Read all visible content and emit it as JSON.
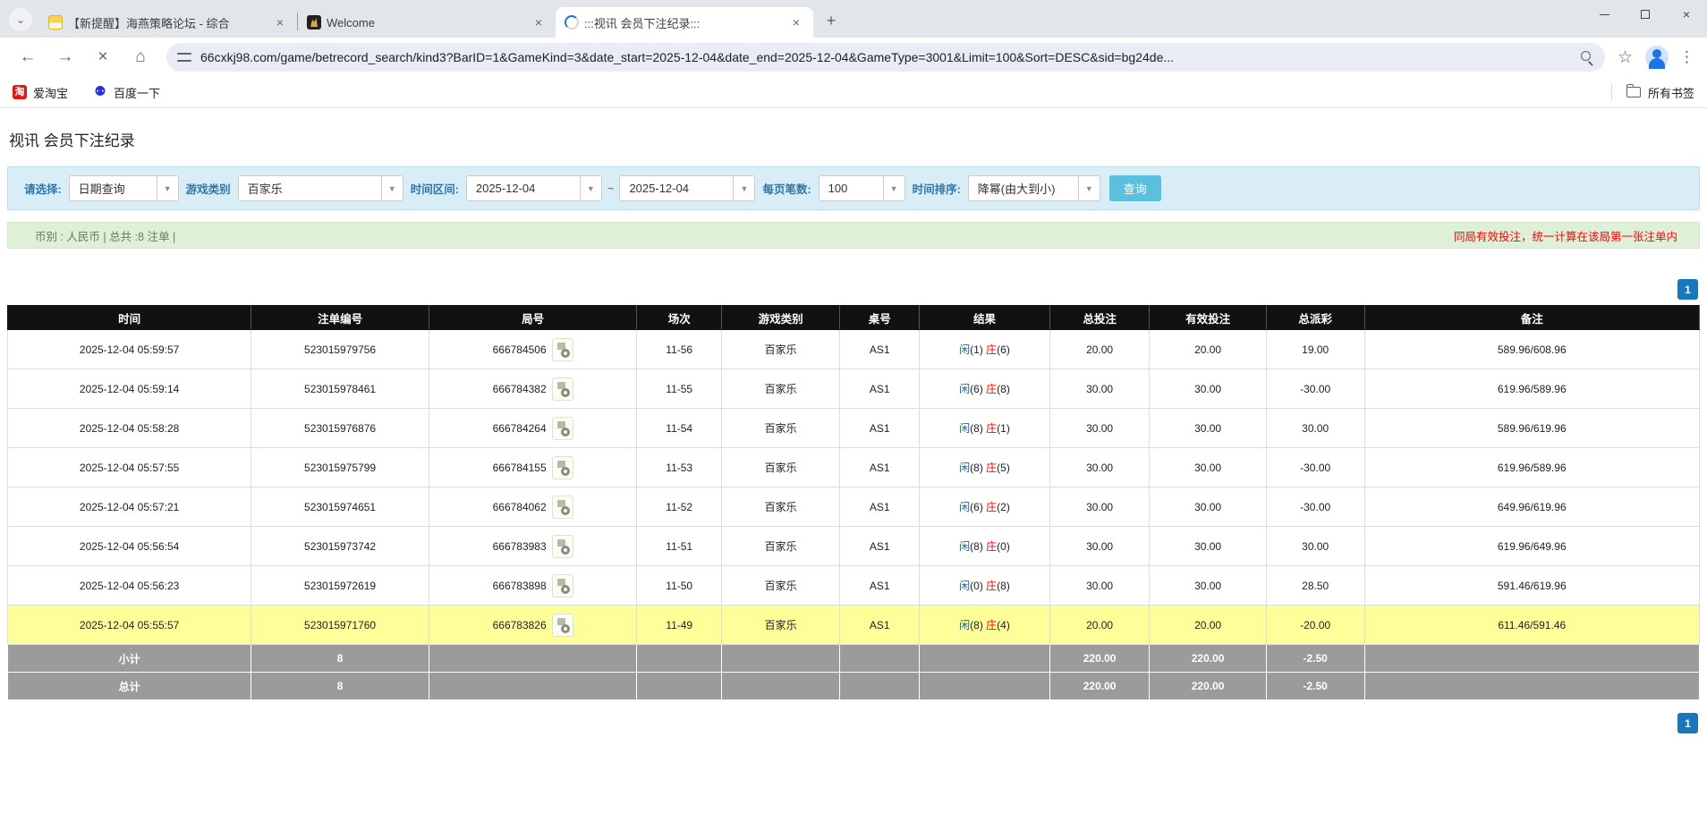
{
  "colors": {
    "accent_blue": "#0066cc",
    "negative_red": "#ff0000",
    "highlight_yellow": "#ffff99",
    "header_black": "#111111",
    "summary_gray": "#9b9b9b",
    "filter_bg": "#d9edf7",
    "info_bg": "#dff0d8",
    "search_button_cyan": "#5bc0de",
    "pagination_blue": "#1778be"
  },
  "browser": {
    "tabs": [
      {
        "title": "【新提醒】海燕策略论坛 - 综合",
        "active": false,
        "favicon": "mail-icon"
      },
      {
        "title": "Welcome",
        "active": false,
        "favicon": "dark-gold-icon"
      },
      {
        "title": ":::视讯 会员下注纪录:::",
        "active": true,
        "favicon": "loading-spinner-icon"
      }
    ],
    "newtab_label": "+",
    "url": "66cxkj98.com/game/betrecord_search/kind3?BarID=1&GameKind=3&date_start=2025-12-04&date_end=2025-12-04&GameType=3001&Limit=100&Sort=DESC&sid=bg24de...",
    "bookmarks": [
      {
        "label": "爱淘宝",
        "icon": "taobao-icon",
        "icon_glyph": "淘"
      },
      {
        "label": "百度一下",
        "icon": "baidu-icon",
        "icon_glyph": "⚉"
      }
    ],
    "all_bookmarks_label": "所有书签"
  },
  "page": {
    "title": "视讯 会员下注纪录",
    "filters": {
      "select_label": "请选择:",
      "select_value": "日期查询",
      "game_label": "游戏类别",
      "game_value": "百家乐",
      "range_label": "时间区间:",
      "date_start": "2025-12-04",
      "tilde": "~",
      "date_end": "2025-12-04",
      "per_page_label": "每页笔数:",
      "per_page_value": "100",
      "sort_label": "时间排序:",
      "sort_value": "降幂(由大到小)",
      "search_button": "查询",
      "dropdown_arrow": "▼"
    },
    "info_bar": {
      "left": "币别 : 人民币 | 总共 :8 注单 |",
      "right": "同局有效投注，统一计算在该局第一张注单内"
    },
    "pagination_page": "1",
    "table": {
      "headers": [
        "时间",
        "注单编号",
        "局号",
        "场次",
        "游戏类别",
        "桌号",
        "结果",
        "总投注",
        "有效投注",
        "总派彩",
        "备注"
      ],
      "rows": [
        {
          "time": "2025-12-04 05:59:57",
          "bet_id": "523015979756",
          "round": "666784506",
          "session": "11-56",
          "game": "百家乐",
          "table_no": "AS1",
          "result": {
            "xian": "闲",
            "xian_n": "(1)",
            "zhuang": "庄",
            "zhuang_n": "(6)"
          },
          "total_bet": "20.00",
          "valid_bet": "20.00",
          "payout": "19.00",
          "remark": "589.96/608.96",
          "highlight": false
        },
        {
          "time": "2025-12-04 05:59:14",
          "bet_id": "523015978461",
          "round": "666784382",
          "session": "11-55",
          "game": "百家乐",
          "table_no": "AS1",
          "result": {
            "xian": "闲",
            "xian_n": "(6)",
            "zhuang": "庄",
            "zhuang_n": "(8)"
          },
          "total_bet": "30.00",
          "valid_bet": "30.00",
          "payout": "-30.00",
          "remark": "619.96/589.96",
          "highlight": false
        },
        {
          "time": "2025-12-04 05:58:28",
          "bet_id": "523015976876",
          "round": "666784264",
          "session": "11-54",
          "game": "百家乐",
          "table_no": "AS1",
          "result": {
            "xian": "闲",
            "xian_n": "(8)",
            "zhuang": "庄",
            "zhuang_n": "(1)"
          },
          "total_bet": "30.00",
          "valid_bet": "30.00",
          "payout": "30.00",
          "remark": "589.96/619.96",
          "highlight": false
        },
        {
          "time": "2025-12-04 05:57:55",
          "bet_id": "523015975799",
          "round": "666784155",
          "session": "11-53",
          "game": "百家乐",
          "table_no": "AS1",
          "result": {
            "xian": "闲",
            "xian_n": "(8)",
            "zhuang": "庄",
            "zhuang_n": "(5)"
          },
          "total_bet": "30.00",
          "valid_bet": "30.00",
          "payout": "-30.00",
          "remark": "619.96/589.96",
          "highlight": false
        },
        {
          "time": "2025-12-04 05:57:21",
          "bet_id": "523015974651",
          "round": "666784062",
          "session": "11-52",
          "game": "百家乐",
          "table_no": "AS1",
          "result": {
            "xian": "闲",
            "xian_n": "(6)",
            "zhuang": "庄",
            "zhuang_n": "(2)"
          },
          "total_bet": "30.00",
          "valid_bet": "30.00",
          "payout": "-30.00",
          "remark": "649.96/619.96",
          "highlight": false
        },
        {
          "time": "2025-12-04 05:56:54",
          "bet_id": "523015973742",
          "round": "666783983",
          "session": "11-51",
          "game": "百家乐",
          "table_no": "AS1",
          "result": {
            "xian": "闲",
            "xian_n": "(8)",
            "zhuang": "庄",
            "zhuang_n": "(0)"
          },
          "total_bet": "30.00",
          "valid_bet": "30.00",
          "payout": "30.00",
          "remark": "619.96/649.96",
          "highlight": false
        },
        {
          "time": "2025-12-04 05:56:23",
          "bet_id": "523015972619",
          "round": "666783898",
          "session": "11-50",
          "game": "百家乐",
          "table_no": "AS1",
          "result": {
            "xian": "闲",
            "xian_n": "(0)",
            "zhuang": "庄",
            "zhuang_n": "(8)"
          },
          "total_bet": "30.00",
          "valid_bet": "30.00",
          "payout": "28.50",
          "remark": "591.46/619.96",
          "highlight": false
        },
        {
          "time": "2025-12-04 05:55:57",
          "bet_id": "523015971760",
          "round": "666783826",
          "session": "11-49",
          "game": "百家乐",
          "table_no": "AS1",
          "result": {
            "xian": "闲",
            "xian_n": "(8)",
            "zhuang": "庄",
            "zhuang_n": "(4)"
          },
          "total_bet": "20.00",
          "valid_bet": "20.00",
          "payout": "-20.00",
          "remark": "611.46/591.46",
          "highlight": true
        }
      ],
      "subtotal": {
        "label": "小计",
        "count": "8",
        "total_bet": "220.00",
        "valid_bet": "220.00",
        "payout": "-2.50"
      },
      "total": {
        "label": "总计",
        "count": "8",
        "total_bet": "220.00",
        "valid_bet": "220.00",
        "payout": "-2.50"
      }
    }
  }
}
